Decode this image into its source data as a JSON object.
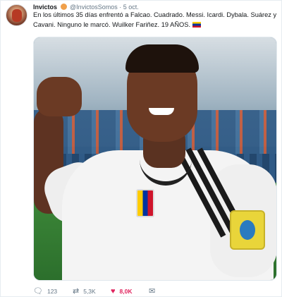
{
  "tweet": {
    "display_name": "Invictos",
    "handle": "@InvictosSomos",
    "separator": "·",
    "time": "5 oct.",
    "text": "En los últimos 35 días enfrentó a Falcao. Cuadrado. Messi. Icardi. Dybala. Suárez y Cavani. Ninguno le marcó. Wuilker Fariñez. 19 AÑOS."
  },
  "actions": {
    "reply_count": "123",
    "retweet_count": "5,3K",
    "like_count": "8,0K"
  },
  "icons": {
    "reply": "reply-icon",
    "retweet": "retweet-icon",
    "like": "heart-icon",
    "dm": "envelope-icon",
    "flag": "venezuela-flag-emoji"
  },
  "colors": {
    "like_active": "#e0245e",
    "secondary_text": "#657786"
  }
}
